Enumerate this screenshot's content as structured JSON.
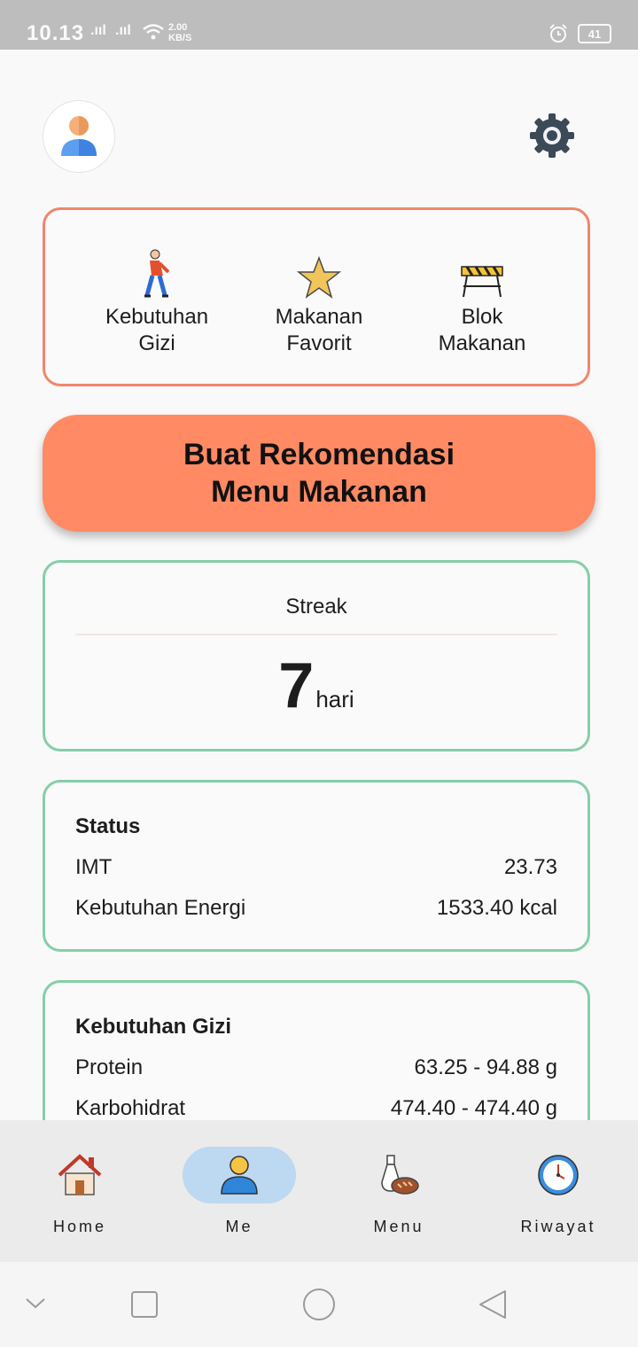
{
  "status_bar": {
    "time": "10.13",
    "signal1": ".ııl",
    "signal2": ".ııl",
    "speed_value": "2.00",
    "speed_unit": "KB/S",
    "battery": "41"
  },
  "header": {
    "avatar_icon": "user-avatar-icon",
    "settings_icon": "gear-icon"
  },
  "quick_menu": [
    {
      "label": "Kebutuhan\nGizi",
      "icon": "person-walking-icon"
    },
    {
      "label": "Makanan\nFavorit",
      "icon": "star-icon"
    },
    {
      "label": "Blok\nMakanan",
      "icon": "barrier-icon"
    }
  ],
  "cta": {
    "label": "Buat Rekomendasi\nMenu Makanan"
  },
  "streak": {
    "title": "Streak",
    "value": "7",
    "unit": "hari"
  },
  "status": {
    "title": "Status",
    "rows": [
      {
        "label": "IMT",
        "value": "23.73"
      },
      {
        "label": "Kebutuhan Energi",
        "value": "1533.40 kcal"
      }
    ]
  },
  "gizi": {
    "title": "Kebutuhan Gizi",
    "rows": [
      {
        "label": "Protein",
        "value": "63.25 - 94.88 g"
      },
      {
        "label": "Karbohidrat",
        "value": "474.40 - 474.40 g"
      }
    ]
  },
  "bottom_nav": [
    {
      "label": "Home",
      "icon": "house-icon",
      "active": false
    },
    {
      "label": "Me",
      "icon": "person-icon",
      "active": true
    },
    {
      "label": "Menu",
      "icon": "food-icon",
      "active": false
    },
    {
      "label": "Riwayat",
      "icon": "clock-icon",
      "active": false
    }
  ],
  "colors": {
    "accent": "#ff8a64",
    "orange_border": "#f1866c",
    "green_border": "#86cea9",
    "nav_active": "#bdd8f1"
  }
}
